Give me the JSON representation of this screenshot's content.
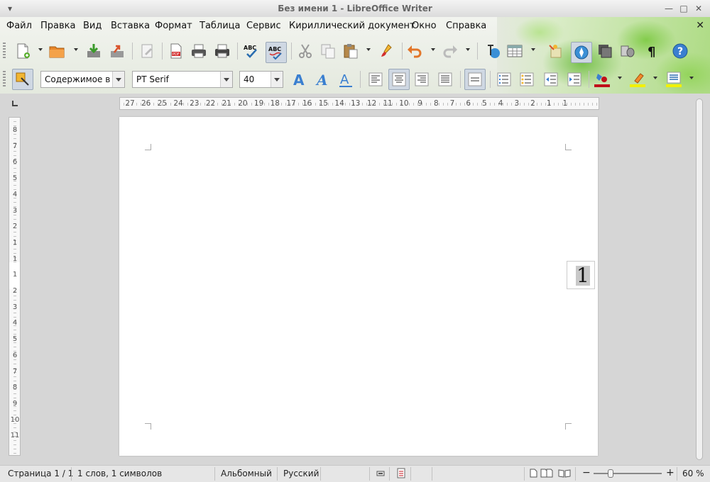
{
  "window": {
    "title": "Без имени 1 - LibreOffice Writer"
  },
  "menu": [
    "Файл",
    "Правка",
    "Вид",
    "Вставка",
    "Формат",
    "Таблица",
    "Сервис",
    "Кириллический документ",
    "Окно",
    "Справка"
  ],
  "formatting": {
    "paragraph_style": "Содержимое в",
    "font_name": "PT Serif",
    "font_size": "40"
  },
  "ruler": {
    "horizontal": [
      "27",
      "26",
      "25",
      "24",
      "23",
      "22",
      "21",
      "20",
      "19",
      "18",
      "17",
      "16",
      "15",
      "14",
      "13",
      "12",
      "11",
      "10",
      "9",
      "8",
      "7",
      "6",
      "5",
      "4",
      "3",
      "2",
      "1",
      "1"
    ],
    "vertical": [
      "8",
      "7",
      "6",
      "5",
      "4",
      "3",
      "2",
      "1",
      "1",
      "1",
      "2",
      "3",
      "4",
      "5",
      "6",
      "7",
      "8",
      "9",
      "10",
      "11"
    ]
  },
  "document": {
    "frame_text": "1"
  },
  "status": {
    "page": "Страница 1 / 1",
    "words": "1 слов, 1 символов",
    "orientation": "Альбомный",
    "language": "Русский",
    "zoom": "60 %"
  },
  "colors": {
    "accent": "#2a6db0",
    "font_color": "#c0101a",
    "highlight": "#f2f000",
    "leaf": "#7cc63f"
  }
}
